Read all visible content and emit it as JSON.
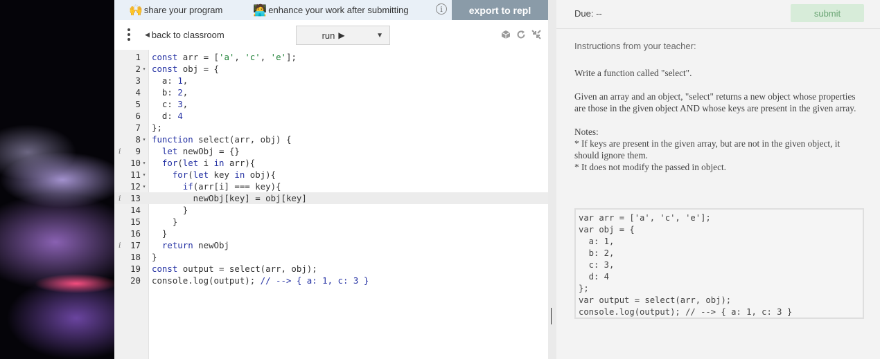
{
  "topbar": {
    "share_emoji": "🙌",
    "share_label": "share your program",
    "enhance_emoji": "🧑‍💻",
    "enhance_label": "enhance your work after submitting",
    "info_glyph": "i",
    "export_label": "export to repl"
  },
  "toolbar": {
    "back_label": "back to classroom",
    "run_label": "run",
    "run_glyph": "▶",
    "dropdown_glyph": "▼",
    "icons": [
      "cube-icon",
      "refresh-icon",
      "collapse-icon"
    ]
  },
  "editor": {
    "lines": [
      {
        "n": "1",
        "fold": "",
        "warn": "",
        "text": "const arr = ['a', 'c', 'e'];"
      },
      {
        "n": "2",
        "fold": "▾",
        "warn": "",
        "text": "const obj = {"
      },
      {
        "n": "3",
        "fold": "",
        "warn": "",
        "text": "  a: 1,"
      },
      {
        "n": "4",
        "fold": "",
        "warn": "",
        "text": "  b: 2,"
      },
      {
        "n": "5",
        "fold": "",
        "warn": "",
        "text": "  c: 3,"
      },
      {
        "n": "6",
        "fold": "",
        "warn": "",
        "text": "  d: 4"
      },
      {
        "n": "7",
        "fold": "",
        "warn": "",
        "text": "};"
      },
      {
        "n": "8",
        "fold": "▾",
        "warn": "",
        "text": "function select(arr, obj) {"
      },
      {
        "n": "9",
        "fold": "",
        "warn": "i",
        "text": "  let newObj = {}"
      },
      {
        "n": "10",
        "fold": "▾",
        "warn": "",
        "text": "  for(let i in arr){"
      },
      {
        "n": "11",
        "fold": "▾",
        "warn": "",
        "text": "    for(let key in obj){"
      },
      {
        "n": "12",
        "fold": "▾",
        "warn": "",
        "text": "      if(arr[i] === key){"
      },
      {
        "n": "13",
        "fold": "",
        "warn": "i",
        "text": "        newObj[key] = obj[key]"
      },
      {
        "n": "14",
        "fold": "",
        "warn": "",
        "text": "      }"
      },
      {
        "n": "15",
        "fold": "",
        "warn": "",
        "text": "    }"
      },
      {
        "n": "16",
        "fold": "",
        "warn": "",
        "text": "  }"
      },
      {
        "n": "17",
        "fold": "",
        "warn": "i",
        "text": "  return newObj"
      },
      {
        "n": "18",
        "fold": "",
        "warn": "",
        "text": "}"
      },
      {
        "n": "19",
        "fold": "",
        "warn": "",
        "text": "const output = select(arr, obj);"
      },
      {
        "n": "20",
        "fold": "",
        "warn": "",
        "text": "console.log(output); // --> { a: 1, c: 3 }"
      }
    ],
    "active_line": "13"
  },
  "right_panel": {
    "due_label": "Due: --",
    "submit_label": "submit",
    "instructions_label": "Instructions from your teacher:",
    "para1": "Write a function called \"select\".",
    "para2": "Given an array and an object, \"select\" returns a new object whose properties are those in the given object AND whose keys are present in the given array.",
    "notes_title": "Notes:",
    "note1": "* If keys are present in the given array, but are not in the given object, it should ignore them.",
    "note2": "* It does not modify the passed in object.",
    "example_code": "var arr = ['a', 'c', 'e'];\nvar obj = {\n  a: 1,\n  b: 2,\n  c: 3,\n  d: 4\n};\nvar output = select(arr, obj);\nconsole.log(output); // --> { a: 1, c: 3 }"
  }
}
